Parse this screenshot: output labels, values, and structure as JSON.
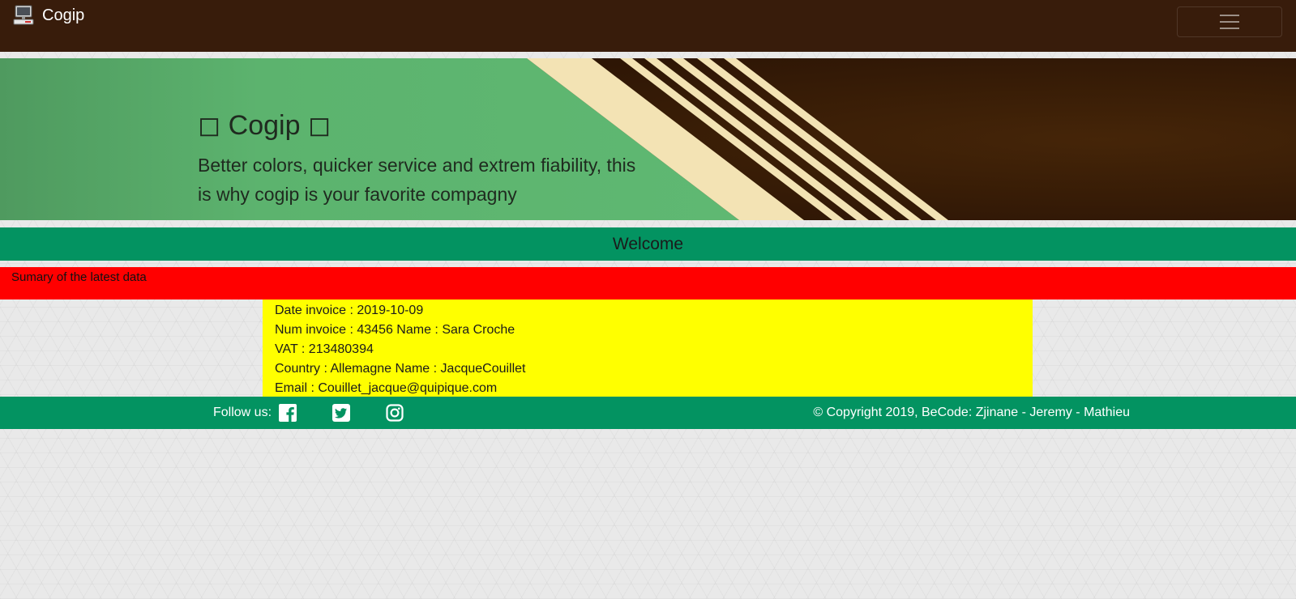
{
  "navbar": {
    "brand_text": "Cogip",
    "brand_icon": "computer-icon",
    "toggle_icon": "hamburger-menu-icon",
    "background": "#381c0b"
  },
  "hero": {
    "title": "◻ Cogip ◻",
    "subtitle": "Better colors, quicker service and extrem fiability, this is why cogip is your favorite compagny",
    "colors": {
      "green": "#5cb36e",
      "cream": "#f3e3b4",
      "brown": "#351a08"
    }
  },
  "welcome": {
    "text": "Welcome",
    "background": "#039361"
  },
  "summary": {
    "title": "Sumary of the latest data",
    "background": "#ff0000"
  },
  "latest": {
    "background": "#ffff00",
    "lines": [
      "Date invoice : 2019-10-09",
      "Num invoice : 43456 Name : Sara Croche",
      "VAT : 213480394",
      "Country : Allemagne Name : JacqueCouillet",
      "Email : Couillet_jacque@quipique.com"
    ]
  },
  "footer": {
    "follow_label": "Follow us:",
    "social_icons": [
      "facebook-icon",
      "twitter-icon",
      "instagram-icon"
    ],
    "copyright": "© Copyright 2019, BeCode: Zjinane - Jeremy - Mathieu",
    "background": "#039361"
  }
}
